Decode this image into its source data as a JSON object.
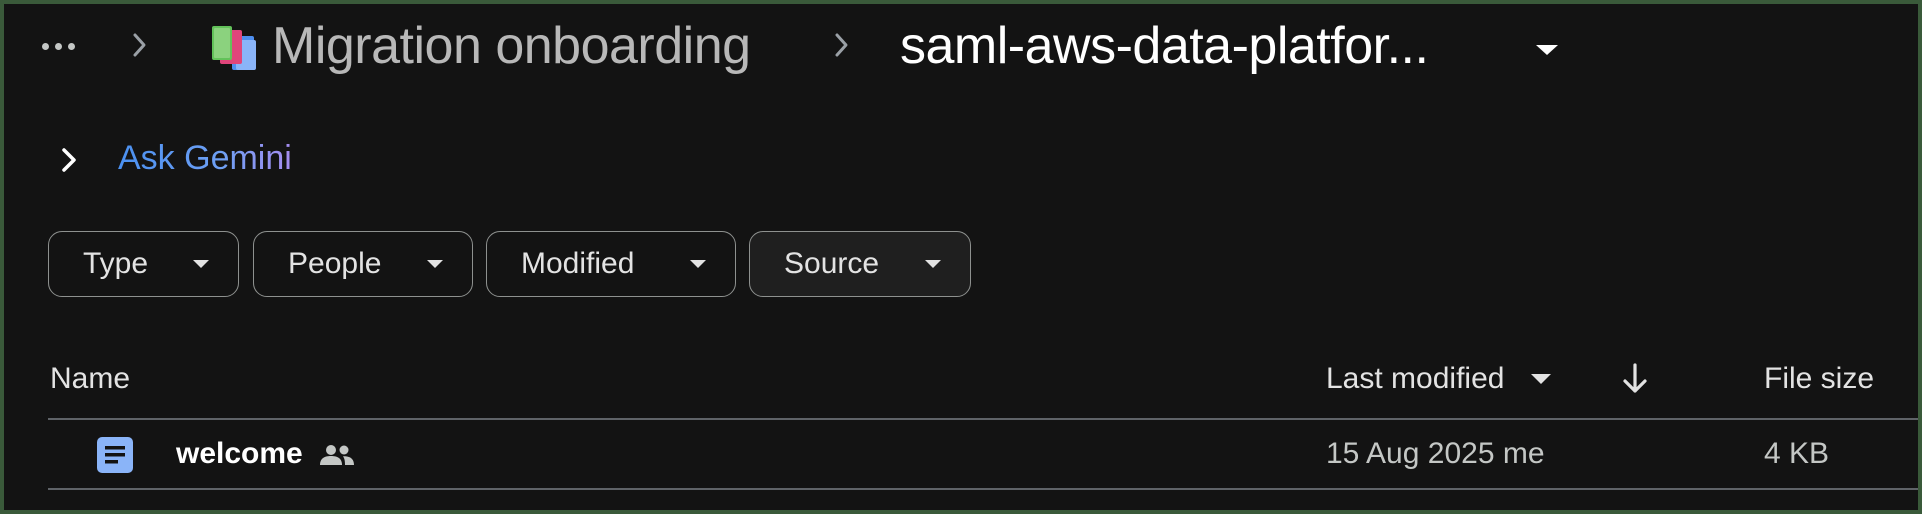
{
  "breadcrumb": {
    "more_icon": "more-horiz-icon",
    "items": [
      {
        "label": "Migration onboarding",
        "icon": "shared-drive-books-icon"
      },
      {
        "label": "saml-aws-data-platfor..."
      }
    ]
  },
  "gemini": {
    "label": "Ask Gemini",
    "gradient_colors": [
      "#4a90f0",
      "#a68cf0"
    ]
  },
  "filters": [
    {
      "label": "Type"
    },
    {
      "label": "People"
    },
    {
      "label": "Modified"
    },
    {
      "label": "Source"
    }
  ],
  "table": {
    "columns": {
      "name": "Name",
      "last_modified": "Last modified",
      "file_size": "File size"
    },
    "rows": [
      {
        "name": "welcome",
        "icon": "google-docs-icon",
        "shared": true,
        "last_modified": "15 Aug 2025 me",
        "file_size": "4 KB"
      }
    ]
  },
  "colors": {
    "background": "#131313",
    "frame_border": "#3a5a3a",
    "doc_icon": "#8ab4f8"
  }
}
